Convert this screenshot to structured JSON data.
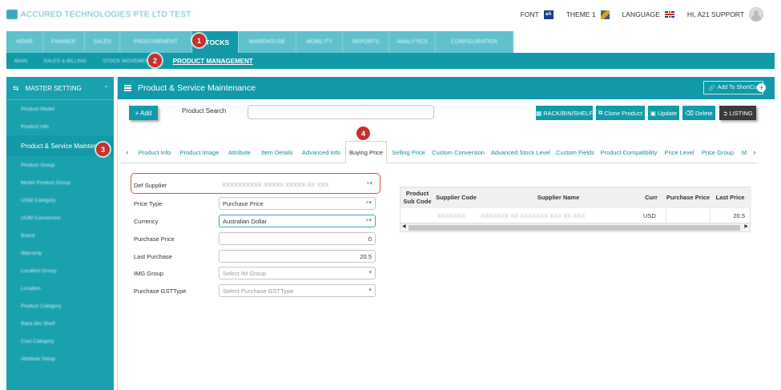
{
  "header": {
    "company": "ACCURED TECHNOLOGIES PTE LTD TEST",
    "font_label": "FONT",
    "font_icon_text": "aA",
    "theme_label": "THEME 1",
    "language_label": "LANGUAGE",
    "user_label": "HI, A21 SUPPORT"
  },
  "modules": [
    {
      "label": "HOME"
    },
    {
      "label": "FINANCE"
    },
    {
      "label": "SALES"
    },
    {
      "label": "PROCUREMENT"
    },
    {
      "label": "STOCKS"
    },
    {
      "label": "WAREHOUSE"
    },
    {
      "label": "MOBILITY"
    },
    {
      "label": "REPORTS"
    },
    {
      "label": "ANALYTICS"
    },
    {
      "label": "CONFIGURATION"
    }
  ],
  "subnav": [
    {
      "label": "MAIN"
    },
    {
      "label": "SALES & BILLING"
    },
    {
      "label": "STOCK MOVEMENT"
    },
    {
      "label": "PRODUCT MANAGEMENT"
    }
  ],
  "badges": [
    "1",
    "2",
    "3",
    "4"
  ],
  "sidebar": {
    "title": "MASTER SETTING",
    "items": [
      {
        "label": "Product Model"
      },
      {
        "label": "Product Info"
      },
      {
        "label": "Product & Service Maintenance"
      },
      {
        "label": "Product Group"
      },
      {
        "label": "Model Product Group"
      },
      {
        "label": "UOM Category"
      },
      {
        "label": "UOM Conversion"
      },
      {
        "label": "Brand"
      },
      {
        "label": "Warranty"
      },
      {
        "label": "Location Group"
      },
      {
        "label": "Location"
      },
      {
        "label": "Product Category"
      },
      {
        "label": "Rack Bin Shelf"
      },
      {
        "label": "Cost Category"
      },
      {
        "label": "Attribute Setup"
      }
    ]
  },
  "main": {
    "title": "Product & Service Maintenance",
    "shortcut_label": "Add To ShortCut",
    "add_label": "+ Add",
    "search_label": "Product Search",
    "search_value": "",
    "actions": {
      "rack": "RACK/BIN/SHELF",
      "clone": "Clone Product",
      "update": "Update",
      "delete": "Delete",
      "listing": "LISTING"
    },
    "tabs": [
      {
        "label": "Product Info"
      },
      {
        "label": "Product Image"
      },
      {
        "label": "Attribute"
      },
      {
        "label": "Item Details"
      },
      {
        "label": "Advanced Info"
      },
      {
        "label": "Buying Price"
      },
      {
        "label": "Selling Price"
      },
      {
        "label": "Custom Conversion"
      },
      {
        "label": "Advanced Stock Level"
      },
      {
        "label": "Custom Fields"
      },
      {
        "label": "Product Compatibility"
      },
      {
        "label": "Price Level"
      },
      {
        "label": "Price Group"
      },
      {
        "label": "M"
      }
    ],
    "form": {
      "def_supplier": {
        "label": "Def Supplier",
        "value": "XXXXXXXXXX XXXXX XXXXX XX XXX"
      },
      "price_type": {
        "label": "Price Type",
        "value": "Purchase Price"
      },
      "currency": {
        "label": "Currency",
        "value": "Australian Dollar"
      },
      "purchase_price": {
        "label": "Purchase Price",
        "value": "0"
      },
      "last_purchase": {
        "label": "Last Purchase",
        "value": "20.5"
      },
      "img_group": {
        "label": "IMG Group",
        "placeholder": "Select IM Group"
      },
      "purchase_gst": {
        "label": "Purchase GSTType",
        "placeholder": "Select Purchase GSTType"
      }
    },
    "grid": {
      "headers": [
        "Product Sub Code",
        "Supplier Code",
        "Supplier Name",
        "Curr",
        "Purchase Price",
        "Last Price"
      ],
      "rows": [
        {
          "sub_code": "",
          "supplier_code": "XXXXXXX",
          "supplier_name": "XXXXXXX XX XXXXXXX XXX XX XXX",
          "curr": "USD",
          "purchase_price": "",
          "last_price": "20.5"
        }
      ]
    }
  }
}
